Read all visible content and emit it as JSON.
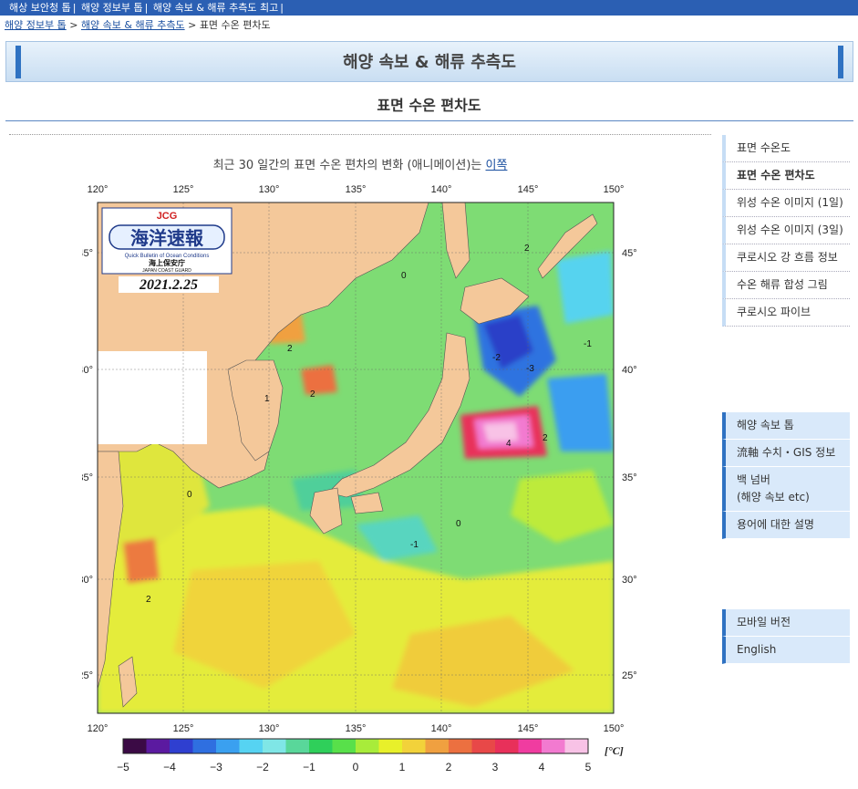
{
  "topnav": {
    "items": [
      "해상 보안청 톱",
      "해양 정보부 톱",
      "해양 속보 & 해류 추측도 최고"
    ],
    "sep": "|"
  },
  "breadcrumb": {
    "items": [
      "해양 정보부 톱",
      "해양 속보 & 해류 추측도"
    ],
    "current": "표면 수온 편차도",
    "sep": ">"
  },
  "header": {
    "title": "해양 속보 & 해류 추측도"
  },
  "page": {
    "subtitle": "표면 수온 편차도",
    "animation_text": "최근 30 일간의 표면 수온 편차의 변화 (애니메이션)는",
    "animation_link": "이쪽"
  },
  "figure": {
    "logo": {
      "top": "JCG",
      "main": "海洋速報",
      "sub": "Quick Bulletin of Ocean Conditions",
      "org": "海上保安庁",
      "org_en": "JAPAN COAST GUARD"
    },
    "date": "2021.2.25",
    "lon_labels": [
      "120°",
      "125°",
      "130°",
      "135°",
      "140°",
      "145°",
      "150°"
    ],
    "lat_labels": [
      "45°",
      "40°",
      "35°",
      "30°",
      "25°"
    ],
    "colorbar_ticks": [
      "−5",
      "−4",
      "−3",
      "−2",
      "−1",
      "0",
      "1",
      "2",
      "3",
      "4",
      "5"
    ],
    "colorbar_unit": "[°C]",
    "colorbar_colors": [
      "#3b0a45",
      "#5b1aa0",
      "#2f3fd0",
      "#2f6fe0",
      "#3aa0f0",
      "#56d3f2",
      "#7fe6e6",
      "#59d79a",
      "#2fcf5a",
      "#58e04a",
      "#a8ec3a",
      "#e8f02a",
      "#f2d23a",
      "#f0a040",
      "#ec7040",
      "#e84848",
      "#e8305a",
      "#f03ca0",
      "#f27ad0",
      "#f8c2e6"
    ],
    "land_color": "#f4c89a",
    "sea_base_color": "#7edc74"
  },
  "sidebar": {
    "group1": [
      "표면 수온도",
      "표면 수온 편차도",
      "위성 수온 이미지 (1일)",
      "위성 수온 이미지 (3일)",
      "쿠로시오 강 흐름 정보",
      "수온 해류 합성 그림",
      "쿠로시오 파이브"
    ],
    "group2": [
      "해양 속보 톱",
      "流軸 수치・GIS 정보",
      "백 넘버",
      "(해양 속보 etc)",
      "용어에 대한 설명"
    ],
    "group3": [
      "모바일 버전",
      "English"
    ]
  }
}
